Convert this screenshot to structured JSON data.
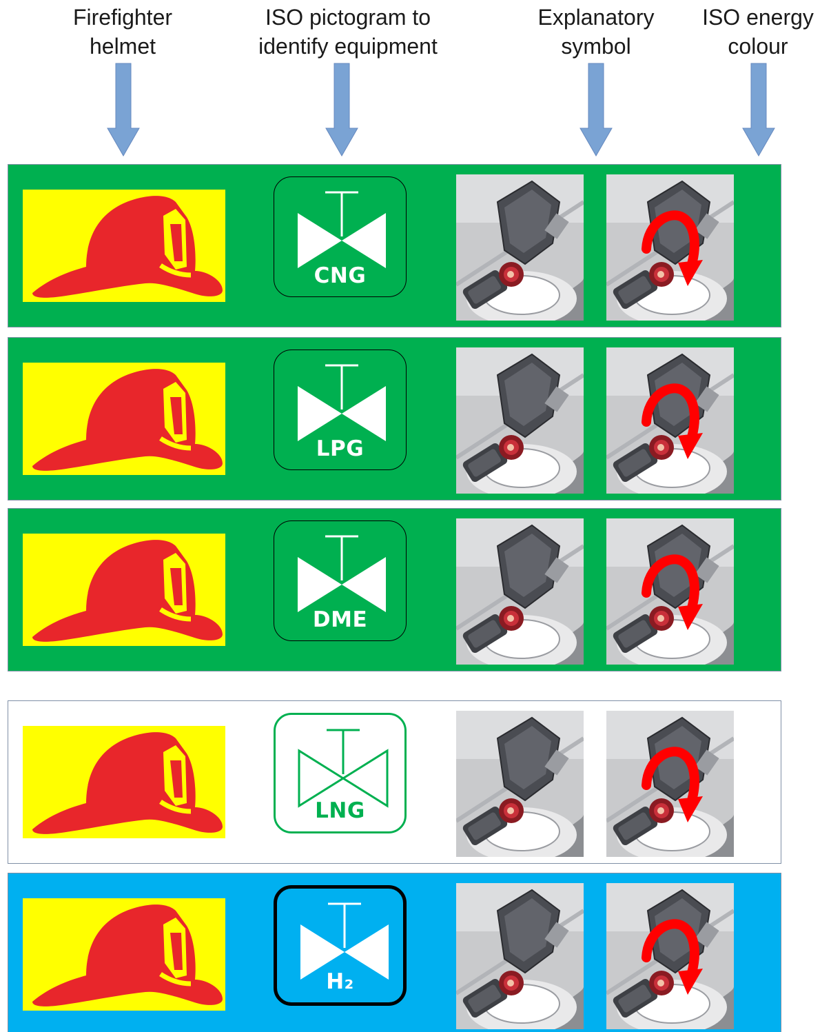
{
  "column_labels": {
    "helmet": "Firefighter\nhelmet",
    "pictogram": "ISO pictogram to\nidentify equipment",
    "explanatory": "Explanatory\nsymbol",
    "energy": "ISO energy\ncolour"
  },
  "colors": {
    "arrow": "#7aa3d4",
    "helmet_bg": "#ffff00",
    "helmet_red": "#e8262b",
    "green": "#00b050",
    "blue": "#00b0f0",
    "white": "#ffffff",
    "black": "#000000"
  },
  "rows": [
    {
      "gas": "CNG",
      "background": "green"
    },
    {
      "gas": "LPG",
      "background": "green"
    },
    {
      "gas": "DME",
      "background": "green"
    },
    {
      "gas": "LNG",
      "background": "white"
    },
    {
      "gas": "H₂",
      "background": "blue"
    }
  ],
  "icons": {
    "helmet": "firefighter-helmet-icon",
    "valve": "valve-icon",
    "photo": "shutoff-valve-photo",
    "rotation": "rotation-arrow-icon"
  }
}
